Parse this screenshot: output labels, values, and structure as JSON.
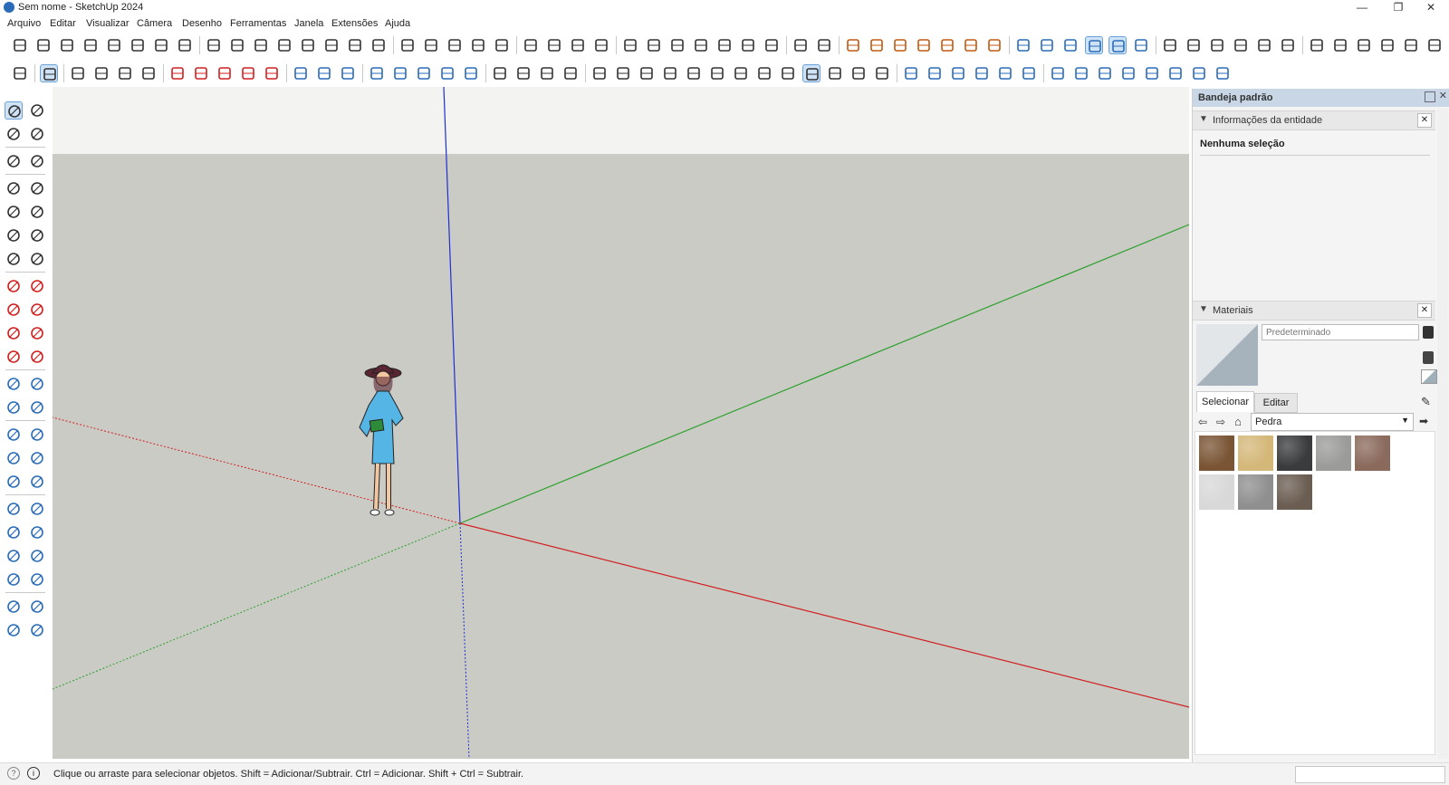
{
  "window": {
    "title": "Sem nome - SketchUp 2024",
    "minimize": "—",
    "restore": "❐",
    "close": "✕"
  },
  "menu": [
    {
      "label": "Arquivo"
    },
    {
      "label": "Editar"
    },
    {
      "label": "Visualizar"
    },
    {
      "label": "Câmera"
    },
    {
      "label": "Desenho"
    },
    {
      "label": "Ferramentas"
    },
    {
      "label": "Janela"
    },
    {
      "label": "Extensões"
    },
    {
      "label": "Ajuda"
    }
  ],
  "colors": {
    "axis_blue": "#1f2fd1",
    "axis_green": "#2aa02a",
    "axis_red": "#d12020",
    "ground": "#cbcbc6",
    "sky": "#f3f3f2",
    "tray_header": "#c8d6e5",
    "material_default": "#a6b3bd"
  },
  "toolbars": {
    "row1": [
      "icon",
      "icon",
      "icon",
      "icon",
      "icon",
      "icon",
      "icon",
      "icon",
      "icon",
      "icon",
      "icon",
      "icon",
      "icon",
      "icon",
      "icon",
      "icon",
      "icon",
      "icon",
      "icon",
      "icon",
      "icon",
      "icon",
      "icon",
      "icon",
      "icon",
      "icon",
      "icon",
      "icon",
      "icon",
      "icon",
      "icon",
      "icon",
      "icon",
      "icon",
      "icon",
      "icon",
      "icon",
      "icon",
      "icon",
      "icon",
      "icon",
      "icon",
      "icon",
      "icon",
      "icon",
      "icon",
      "icon",
      "icon",
      "icon",
      "icon"
    ],
    "row2": [
      "search-icon",
      "select-icon",
      "eraser-icon",
      "pencil-icon",
      "arc-icon",
      "rectangle-icon",
      "push-pull-icon",
      "follow-me-icon",
      "move-icon",
      "rotate-icon",
      "scale-icon",
      "offset-icon",
      "tape-icon",
      "protractor-icon",
      "section-icon",
      "orbit-icon",
      "pan-icon",
      "zoom-icon",
      "zoom-extents-icon",
      "layers-icon",
      "styles-icon",
      "scenes-icon",
      "user-icon",
      "new-icon",
      "profile-icon",
      "open-icon",
      "settings-icon",
      "stop-icon"
    ]
  },
  "tray": {
    "title": "Bandeja padrão",
    "entity_info": {
      "title": "Informações da entidade",
      "selection": "Nenhuma seleção"
    },
    "materials": {
      "title": "Materiais",
      "name_placeholder": "Predeterminado",
      "tabs": [
        "Selecionar",
        "Editar"
      ],
      "category": "Pedra",
      "swatches": [
        {
          "name": "stone-brown",
          "color": "#7a5535"
        },
        {
          "name": "stone-sand",
          "color": "#d4b879"
        },
        {
          "name": "stone-dark",
          "color": "#3a3b3d"
        },
        {
          "name": "stone-gray",
          "color": "#9b9b99"
        },
        {
          "name": "stone-granite-brown",
          "color": "#8a6a5c"
        },
        {
          "name": "stone-marble-white",
          "color": "#d8d8d8"
        },
        {
          "name": "stone-gray-speckle",
          "color": "#8f8f8f"
        },
        {
          "name": "stone-granite-dark",
          "color": "#6b5d52"
        }
      ]
    }
  },
  "status": {
    "message": "Clique ou arraste para selecionar objetos. Shift = Adicionar/Subtrair. Ctrl = Adicionar. Shift + Ctrl = Subtrair."
  }
}
